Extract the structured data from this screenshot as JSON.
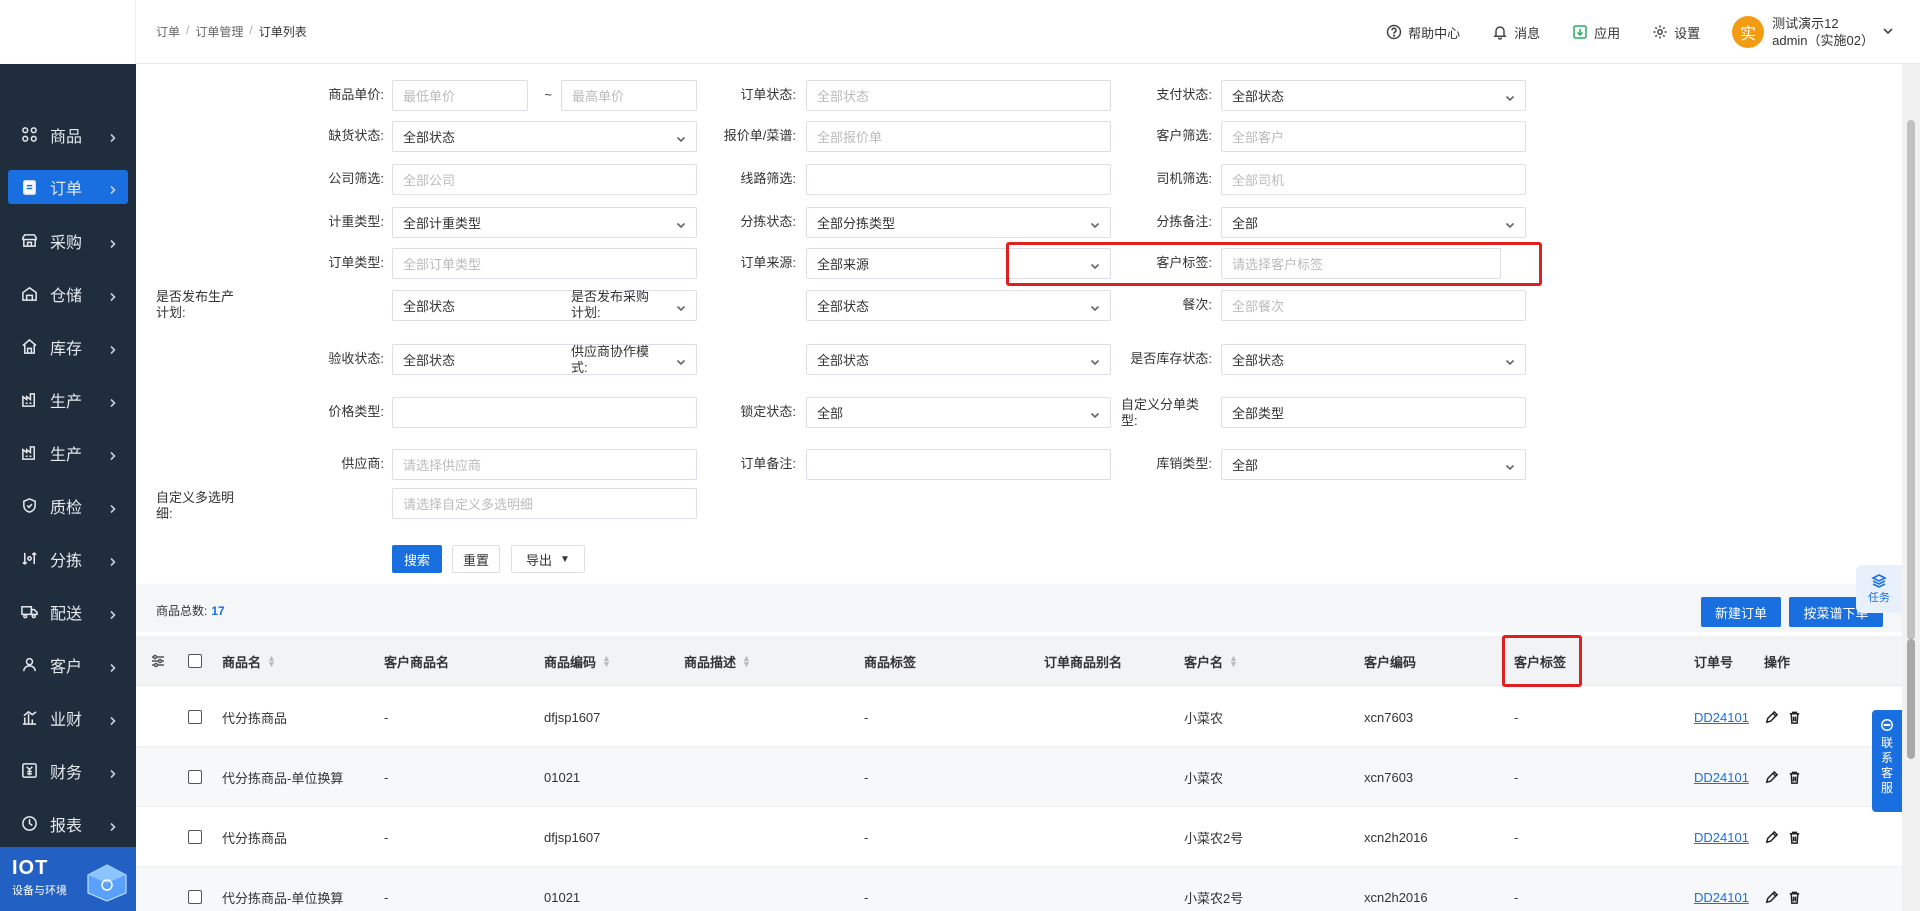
{
  "breadcrumb": [
    "订单",
    "订单管理",
    "订单列表"
  ],
  "header": {
    "help": "帮助中心",
    "messages": "消息",
    "apps": "应用",
    "settings": "设置",
    "avatar_char": "实",
    "user_name": "测试演示12",
    "user_sub": "admin（实施02）"
  },
  "sidebar": {
    "items": [
      {
        "label": "商品",
        "icon": "grid-icon"
      },
      {
        "label": "订单",
        "icon": "order-icon",
        "active": true
      },
      {
        "label": "采购",
        "icon": "shop-icon"
      },
      {
        "label": "仓储",
        "icon": "warehouse-icon"
      },
      {
        "label": "库存",
        "icon": "home-icon"
      },
      {
        "label": "生产",
        "icon": "factory-icon"
      },
      {
        "label": "生产",
        "icon": "factory-icon"
      },
      {
        "label": "质检",
        "icon": "shield-icon"
      },
      {
        "label": "分拣",
        "icon": "sort-icon"
      },
      {
        "label": "配送",
        "icon": "truck-icon"
      },
      {
        "label": "客户",
        "icon": "user-icon"
      },
      {
        "label": "业财",
        "icon": "chart-icon"
      },
      {
        "label": "财务",
        "icon": "finance-icon"
      },
      {
        "label": "报表",
        "icon": "clock-icon"
      }
    ],
    "iot_title": "IOT",
    "iot_sub": "设备与环境"
  },
  "filters": {
    "unit_price_label": "商品单价:",
    "unit_price_min": "最低单价",
    "unit_price_sep": "~",
    "unit_price_max": "最高单价",
    "order_status_label": "订单状态:",
    "order_status": "全部状态",
    "pay_status_label": "支付状态:",
    "pay_status": "全部状态",
    "stockout_label": "缺货状态:",
    "stockout": "全部状态",
    "quote_label": "报价单/菜谱:",
    "quote": "全部报价单",
    "customer_label": "客户筛选:",
    "customer": "全部客户",
    "company_label": "公司筛选:",
    "company": "全部公司",
    "route_label": "线路筛选:",
    "route": "",
    "driver_label": "司机筛选:",
    "driver": "全部司机",
    "weigh_label": "计重类型:",
    "weigh": "全部计重类型",
    "sort_status_label": "分拣状态:",
    "sort_status": "全部分拣类型",
    "sort_note_label": "分拣备注:",
    "sort_note": "全部",
    "order_type_label": "订单类型:",
    "order_type": "全部订单类型",
    "order_source_label": "订单来源:",
    "order_source": "全部来源",
    "cust_tag_label": "客户标签:",
    "cust_tag": "请选择客户标签",
    "prod_plan_label": "是否发布生产计划:",
    "prod_plan": "全部状态",
    "purchase_plan_label": "是否发布采购计划:",
    "purchase_plan": "全部状态",
    "meal_label": "餐次:",
    "meal": "全部餐次",
    "accept_label": "验收状态:",
    "accept": "全部状态",
    "supplier_mode_label": "供应商协作模式:",
    "supplier_mode": "全部状态",
    "stock_status_label": "是否库存状态:",
    "stock_status": "全部状态",
    "price_type_label": "价格类型:",
    "price_type": "",
    "lock_label": "锁定状态:",
    "lock": "全部",
    "split_label": "自定义分单类型:",
    "split": "全部类型",
    "supplier_label": "供应商:",
    "supplier": "请选择供应商",
    "order_note_label": "订单备注:",
    "order_note": "",
    "stock_sale_label": "库销类型:",
    "stock_sale": "全部",
    "multi_label": "自定义多选明细:",
    "multi": "请选择自定义多选明细"
  },
  "actions": {
    "search": "搜索",
    "reset": "重置",
    "export": "导出",
    "new_order": "新建订单",
    "recipe_order": "按菜谱下单"
  },
  "summary": {
    "label": "商品总数:",
    "count": "17"
  },
  "table": {
    "headers": [
      "商品名",
      "客户商品名",
      "商品编码",
      "商品描述",
      "商品标签",
      "订单商品别名",
      "客户名",
      "客户编码",
      "客户标签",
      "订单号",
      "操作"
    ],
    "rows": [
      {
        "name": "代分拣商品",
        "cust_name": "-",
        "code": "dfjsp1607",
        "tag": "-",
        "customer": "小菜农",
        "cust_code": "xcn7603",
        "cust_tag": "-",
        "order_no": "DD24101"
      },
      {
        "name": "代分拣商品-单位换算",
        "cust_name": "-",
        "code": "01021",
        "tag": "-",
        "customer": "小菜农",
        "cust_code": "xcn7603",
        "cust_tag": "-",
        "order_no": "DD24101"
      },
      {
        "name": "代分拣商品",
        "cust_name": "-",
        "code": "dfjsp1607",
        "tag": "-",
        "customer": "小菜农2号",
        "cust_code": "xcn2h2016",
        "cust_tag": "-",
        "order_no": "DD24101"
      },
      {
        "name": "代分拣商品-单位换算",
        "cust_name": "-",
        "code": "01021",
        "tag": "-",
        "customer": "小菜农2号",
        "cust_code": "xcn2h2016",
        "cust_tag": "-",
        "order_no": "DD24101"
      }
    ]
  },
  "float": {
    "task": "任务",
    "service": [
      "联",
      "系",
      "客",
      "服"
    ]
  },
  "colors": {
    "sidebar": "#1f2d3d",
    "accent": "#1a6fe0",
    "highlight": "#e02020"
  }
}
